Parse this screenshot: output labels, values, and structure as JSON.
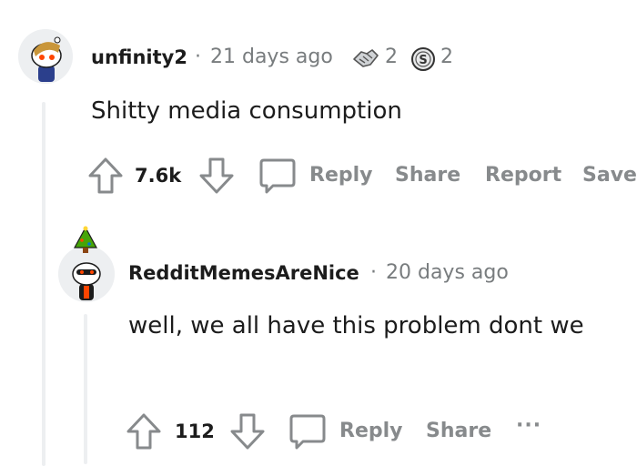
{
  "comment1": {
    "username": "unfinity2",
    "separator": "·",
    "timestamp": "21 days ago",
    "award1_count": "2",
    "award2_count": "2",
    "body": "Shitty media consumption",
    "score": "7.6k",
    "actions": {
      "reply": "Reply",
      "share": "Share",
      "report": "Report",
      "save": "Save"
    }
  },
  "comment2": {
    "username": "RedditMemesAreNice",
    "separator": "·",
    "timestamp": "20 days ago",
    "body": "well, we all have this problem dont we",
    "score": "112",
    "actions": {
      "reply": "Reply",
      "share": "Share",
      "more": "···"
    }
  },
  "colors": {
    "muted": "#878a8c",
    "text": "#1c1c1c",
    "thread": "#edeff1",
    "avatar_accent": "#ff4500"
  }
}
